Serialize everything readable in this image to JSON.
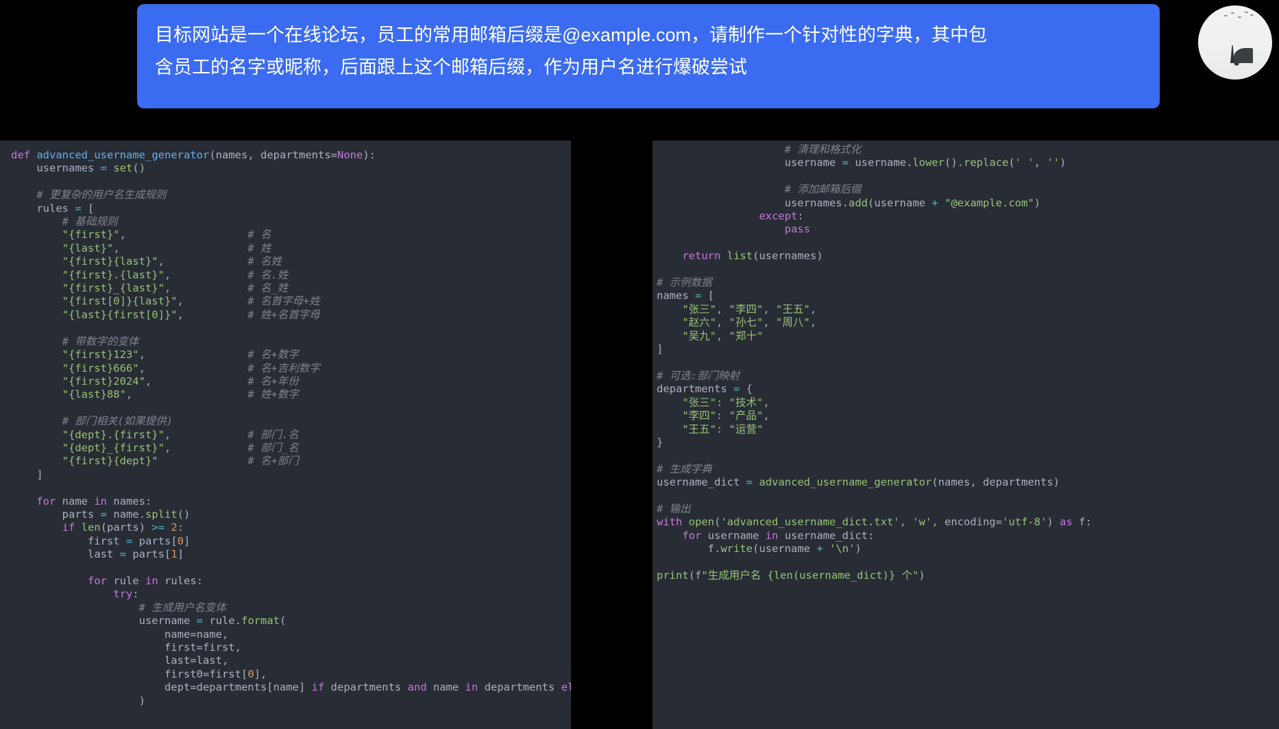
{
  "chat": {
    "message_lines": [
      "目标网站是一个在线论坛，员工的常用邮箱后缀是@example.com，请制作一个针对性的字典，其中包",
      "含员工的名字或昵称，后面跟上这个邮箱后缀，作为用户名进行爆破尝试"
    ],
    "bubble_color": "#3A6BF0",
    "avatar_label": "user-avatar"
  },
  "editor": {
    "background": "#282c34",
    "foreground": "#abb2bf",
    "language": "python",
    "left_panel": {
      "lines": [
        "def advanced_username_generator(names, departments=None):",
        "    usernames = set()",
        "",
        "    # 更复杂的用户名生成规则",
        "    rules = [",
        "        # 基础规则",
        "        \"{first}\",                   # 名",
        "        \"{last}\",                    # 姓",
        "        \"{first}{last}\",             # 名姓",
        "        \"{first}.{last}\",            # 名.姓",
        "        \"{first}_{last}\",            # 名_姓",
        "        \"{first[0]}{last}\",          # 名首字母+姓",
        "        \"{last}{first[0]}\",          # 姓+名首字母",
        "",
        "        # 带数字的变体",
        "        \"{first}123\",                # 名+数字",
        "        \"{first}666\",                # 名+吉利数字",
        "        \"{first}2024\",               # 名+年份",
        "        \"{last}88\",                  # 姓+数字",
        "",
        "        # 部门相关(如果提供)",
        "        \"{dept}.{first}\",            # 部门.名",
        "        \"{dept}_{first}\",            # 部门_名",
        "        \"{first}{dept}\"              # 名+部门",
        "    ]",
        "",
        "    for name in names:",
        "        parts = name.split()",
        "        if len(parts) >= 2:",
        "            first = parts[0]",
        "            last = parts[1]",
        "",
        "            for rule in rules:",
        "                try:",
        "                    # 生成用户名变体",
        "                    username = rule.format(",
        "                        name=name,",
        "                        first=first,",
        "                        last=last,",
        "                        first0=first[0],",
        "                        dept=departments[name] if departments and name in departments else",
        "                    )"
      ]
    },
    "right_panel": {
      "lines": [
        "                    # 清理和格式化",
        "                    username = username.lower().replace(' ', '')",
        "",
        "                    # 添加邮箱后缀",
        "                    usernames.add(username + \"@example.com\")",
        "                except:",
        "                    pass",
        "",
        "    return list(usernames)",
        "",
        "# 示例数据",
        "names = [",
        "    \"张三\", \"李四\", \"王五\",",
        "    \"赵六\", \"孙七\", \"周八\",",
        "    \"吴九\", \"郑十\"",
        "]",
        "",
        "# 可选:部门映射",
        "departments = {",
        "    \"张三\": \"技术\",",
        "    \"李四\": \"产品\",",
        "    \"王五\": \"运营\"",
        "}",
        "",
        "# 生成字典",
        "username_dict = advanced_username_generator(names, departments)",
        "",
        "# 输出",
        "with open('advanced_username_dict.txt', 'w', encoding='utf-8') as f:",
        "    for username in username_dict:",
        "        f.write(username + '\\n')",
        "",
        "print(f\"生成用户名 {len(username_dict)} 个\")"
      ]
    },
    "syntax_colors": {
      "keyword": "#c678dd",
      "function": "#61afef",
      "string": "#98c379",
      "number": "#d19a66",
      "comment": "#7f848e",
      "operator": "#56b6c2",
      "builtin": "#98c379"
    }
  }
}
